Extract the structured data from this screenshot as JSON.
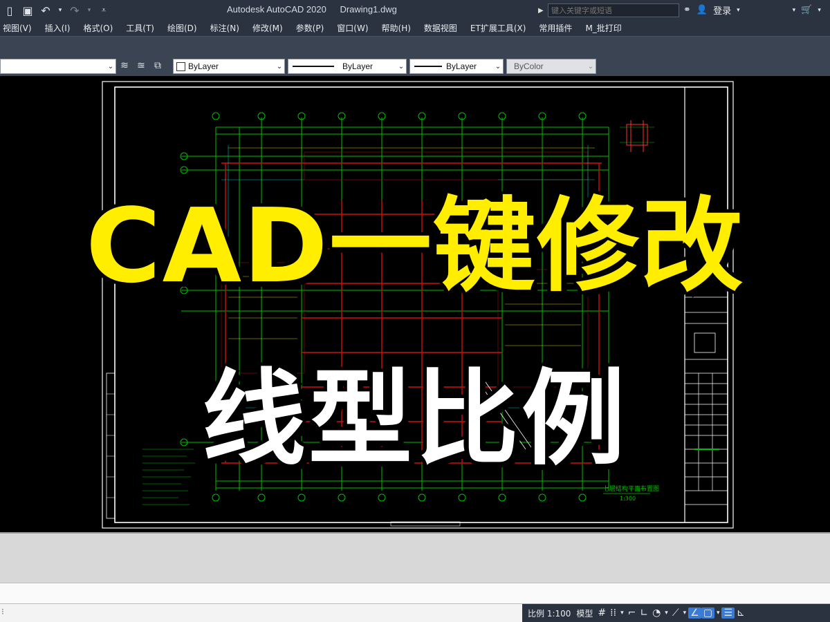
{
  "window": {
    "app_title": "Autodesk AutoCAD 2020",
    "file_title": "Drawing1.dwg"
  },
  "search": {
    "placeholder": "键入关键字或短语"
  },
  "user": {
    "login_label": "登录"
  },
  "menu": [
    "视图(V)",
    "插入(I)",
    "格式(O)",
    "工具(T)",
    "绘图(D)",
    "标注(N)",
    "修改(M)",
    "参数(P)",
    "窗口(W)",
    "帮助(H)",
    "数据视图",
    "ET扩展工具(X)",
    "常用插件",
    "M_批打印"
  ],
  "properties": {
    "color": "ByLayer",
    "linetype": "ByLayer",
    "lineweight": "ByLayer",
    "plotstyle": "ByColor"
  },
  "drawing": {
    "sheet_title": "七层结构平面布置图",
    "sheet_scale": "1:300"
  },
  "overlay": {
    "headline_1": "CAD一键修改",
    "headline_2": "线型比例"
  },
  "status": {
    "scale": "比例 1:100",
    "model": "模型"
  },
  "colors": {
    "titlebar": "#2b3340",
    "toolbar": "#3b4453",
    "headline_yellow": "#ffee00",
    "drawing_green": "#00c000",
    "drawing_red": "#d01010"
  },
  "icons": {
    "qat": [
      "new-file-icon",
      "save-icon",
      "undo-icon",
      "redo-icon",
      "dropdown-icon"
    ],
    "top_right": [
      "binoculars-icon",
      "user-icon",
      "cart-icon",
      "help-icon"
    ]
  }
}
